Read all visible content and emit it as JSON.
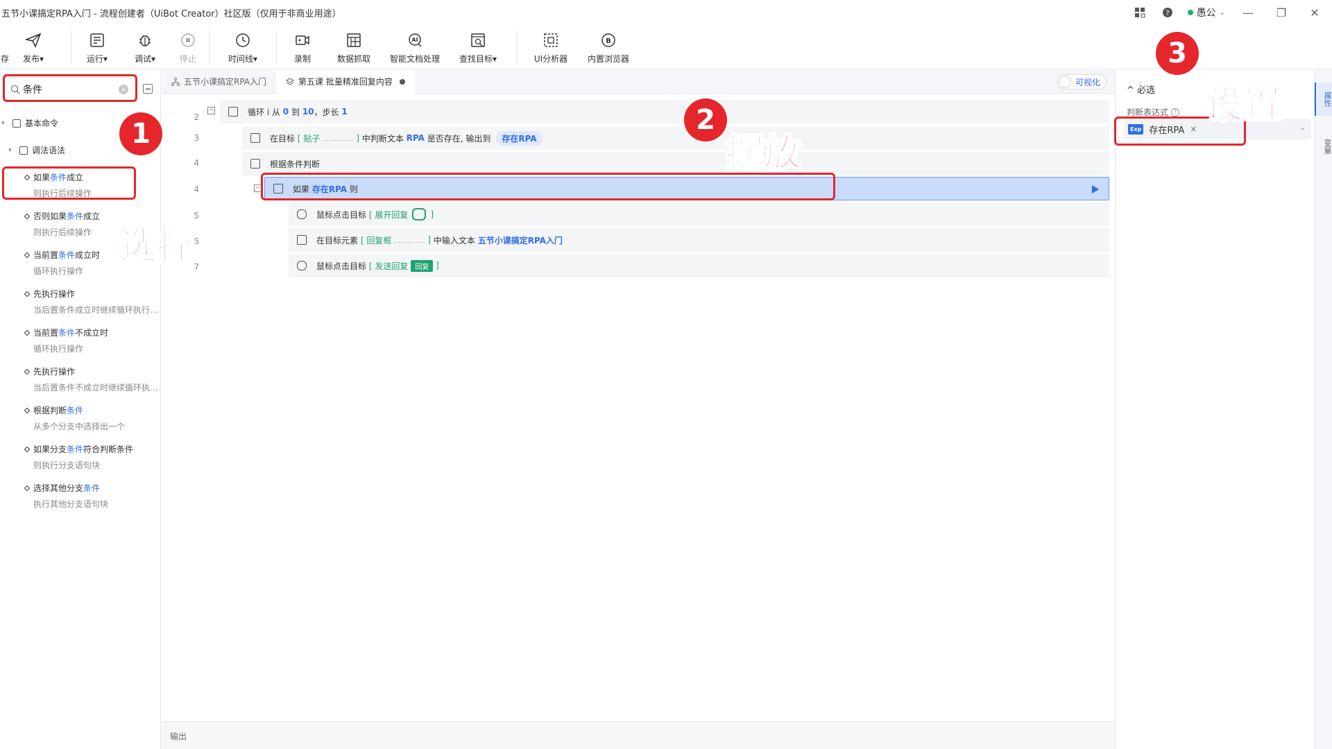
{
  "window": {
    "title": "五节小课搞定RPA入门 - 流程创建者（UiBot Creator）社区版（仅用于非商业用途）",
    "user_name": "愚公"
  },
  "toolbar": {
    "partial_left": "存",
    "publish": "发布",
    "run": "运行",
    "debug": "调试",
    "stop": "停止",
    "timeline": "时间线",
    "record": "录制",
    "data_scrape": "数据抓取",
    "ai_doc": "智能文档处理",
    "find_target": "查找目标",
    "ui_analyzer": "UI分析器",
    "builtin_browser": "内置浏览器"
  },
  "left": {
    "search_value": "条件",
    "tree_root": "基本命令",
    "tree_group": "调法语法",
    "commands": [
      {
        "pre": "如果",
        "hl": "条件",
        "post": "成立",
        "desc": "则执行后续操作"
      },
      {
        "pre": "否则如果",
        "hl": "条件",
        "post": "成立",
        "desc": "则执行后续操作"
      },
      {
        "pre": "当前置",
        "hl": "条件",
        "post": "成立时",
        "desc": "循环执行操作"
      },
      {
        "pre": "先执行操作",
        "hl": "",
        "post": "",
        "desc": "当后置条件成立时继续循环执行..."
      },
      {
        "pre": "当前置",
        "hl": "条件",
        "post": "不成立时",
        "desc": "循环执行操作"
      },
      {
        "pre": "先执行操作",
        "hl": "",
        "post": "",
        "desc": "当后置条件不成立时继续循环执..."
      },
      {
        "pre": "根据判断",
        "hl": "条件",
        "post": "",
        "desc": "从多个分支中选择出一个"
      },
      {
        "pre": "如果分支",
        "hl": "条件",
        "post": "符合判断条件",
        "desc": "则执行分支语句块"
      },
      {
        "pre": "选择其他分支",
        "hl": "条件",
        "post": "",
        "desc": "执行其他分支语句块"
      }
    ]
  },
  "tabs": [
    {
      "label": "五节小课搞定RPA入门"
    },
    {
      "label": "第五课 批量精准回复内容"
    }
  ],
  "visual_toggle": "可视化",
  "code_lines": {
    "l1_num": "2",
    "l1_a": "循环 i 从",
    "l1_b": "0",
    "l1_c": "到",
    "l1_d": "10",
    "l1_e": "，步长",
    "l1_f": "1",
    "l2_num": "3",
    "l2_a": "在目标",
    "l2_b": "[ 贴子",
    "l2_c": "]",
    "l2_d": "中判断文本",
    "l2_e": "RPA",
    "l2_f": "是否存在, 输出到",
    "l2_g": "存在RPA",
    "l3_num": "4",
    "l3_a": "根据条件判断",
    "l4_num": "4",
    "l4_a": "如果",
    "l4_b": "存在RPA",
    "l4_c": "则",
    "l5_num": "5",
    "l5_a": "鼠标点击目标",
    "l5_b": "[ 展开回复",
    "l5_c": "]",
    "l6_num": "6",
    "l6_a": "在目标元素",
    "l6_b": "[ 回复框",
    "l6_c": "]",
    "l6_d": "中输入文本",
    "l6_e": "五节小课搞定RPA入门",
    "l7_num": "7",
    "l7_a": "鼠标点击目标",
    "l7_b": "[ 发送回复",
    "l7_c": "回复",
    "l7_d": "]"
  },
  "output_label": "输出",
  "right": {
    "section": "^ 必选",
    "field_label": "判断表达式",
    "expr_badge": "Exp",
    "expr_value": "存在RPA",
    "side_tab_props": "属性",
    "side_tab_vars": "变量"
  },
  "annotations": {
    "n1": "1",
    "n2": "2",
    "n3": "3",
    "select": "选择",
    "place": "摆放",
    "set": "设置"
  }
}
